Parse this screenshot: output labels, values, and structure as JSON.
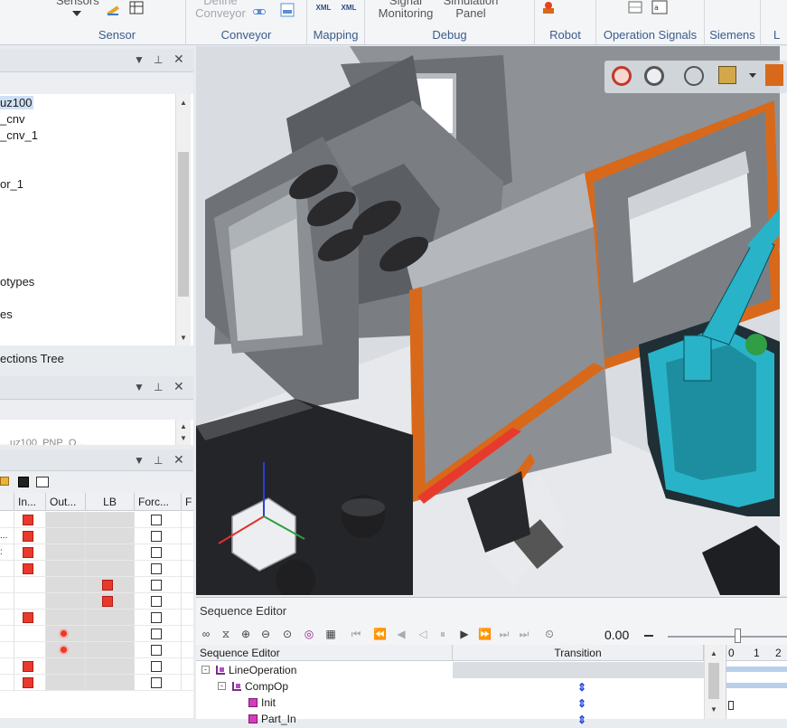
{
  "ribbon": {
    "groups": [
      {
        "label": "Sensor",
        "top_texts": [
          "Sensors"
        ]
      },
      {
        "label": "Conveyor",
        "top_texts": [
          "Define",
          "Conveyor"
        ]
      },
      {
        "label": "Mapping",
        "top_texts": [
          "XML",
          "XML"
        ]
      },
      {
        "label": "Debug",
        "top_texts": [
          "Signal",
          "Monitoring",
          "Simulation",
          "Panel"
        ]
      },
      {
        "label": "Robot",
        "top_texts": []
      },
      {
        "label": "Operation Signals",
        "top_texts": []
      },
      {
        "label": "Siemens",
        "top_texts": []
      },
      {
        "label": "L",
        "top_texts": []
      }
    ]
  },
  "tree_panel": {
    "items": [
      "uz100",
      "_cnv",
      "_cnv_1",
      "or_1",
      "otypes",
      "es"
    ],
    "selected_index": 0,
    "footer_tab": "ections Tree"
  },
  "second_panel": {
    "partial_text": "…uz100_PNP_O…"
  },
  "grid_panel": {
    "columns": [
      "In...",
      "Out...",
      "LB",
      "Forc...",
      "F"
    ],
    "row_prefixes": [
      "",
      "...",
      ":",
      "",
      "",
      "",
      "",
      "",
      "",
      "",
      ""
    ],
    "rows": [
      {
        "in": true,
        "out": false,
        "lb": false,
        "force": false
      },
      {
        "in": true,
        "out": false,
        "lb": false,
        "force": false
      },
      {
        "in": true,
        "out": false,
        "lb": false,
        "force": false
      },
      {
        "in": true,
        "out": false,
        "lb": false,
        "force": false
      },
      {
        "in": false,
        "out": false,
        "lb": true,
        "force": false
      },
      {
        "in": false,
        "out": false,
        "lb": true,
        "force": false
      },
      {
        "in": true,
        "out": false,
        "lb": false,
        "force": false
      },
      {
        "in": false,
        "out": "circle",
        "lb": false,
        "force": false
      },
      {
        "in": false,
        "out": "circle",
        "lb": false,
        "force": false
      },
      {
        "in": true,
        "out": false,
        "lb": false,
        "force": false
      },
      {
        "in": true,
        "out": false,
        "lb": false,
        "force": false
      }
    ]
  },
  "sequence_editor": {
    "title": "Sequence Editor",
    "time_value": "0.00",
    "columns": [
      "Sequence Editor",
      "Transition"
    ],
    "rows": [
      {
        "label": "LineOperation",
        "level": 0,
        "toggle": "-",
        "icon": "tree-node-icon",
        "transition": false
      },
      {
        "label": "CompOp",
        "level": 1,
        "toggle": "-",
        "icon": "tree-node-icon",
        "transition": true
      },
      {
        "label": "Init",
        "level": 2,
        "toggle": "",
        "icon": "op-square-icon",
        "transition": true
      },
      {
        "label": "Part_In",
        "level": 2,
        "toggle": "",
        "icon": "op-square-icon",
        "transition": true
      }
    ],
    "gantt_ticks": [
      "0",
      "1",
      "2"
    ]
  },
  "colors": {
    "accent": "#3a5c8c",
    "signal_red": "#e83a2c",
    "robot_cyan": "#29b3c9",
    "machine_orange": "#d8691a"
  }
}
